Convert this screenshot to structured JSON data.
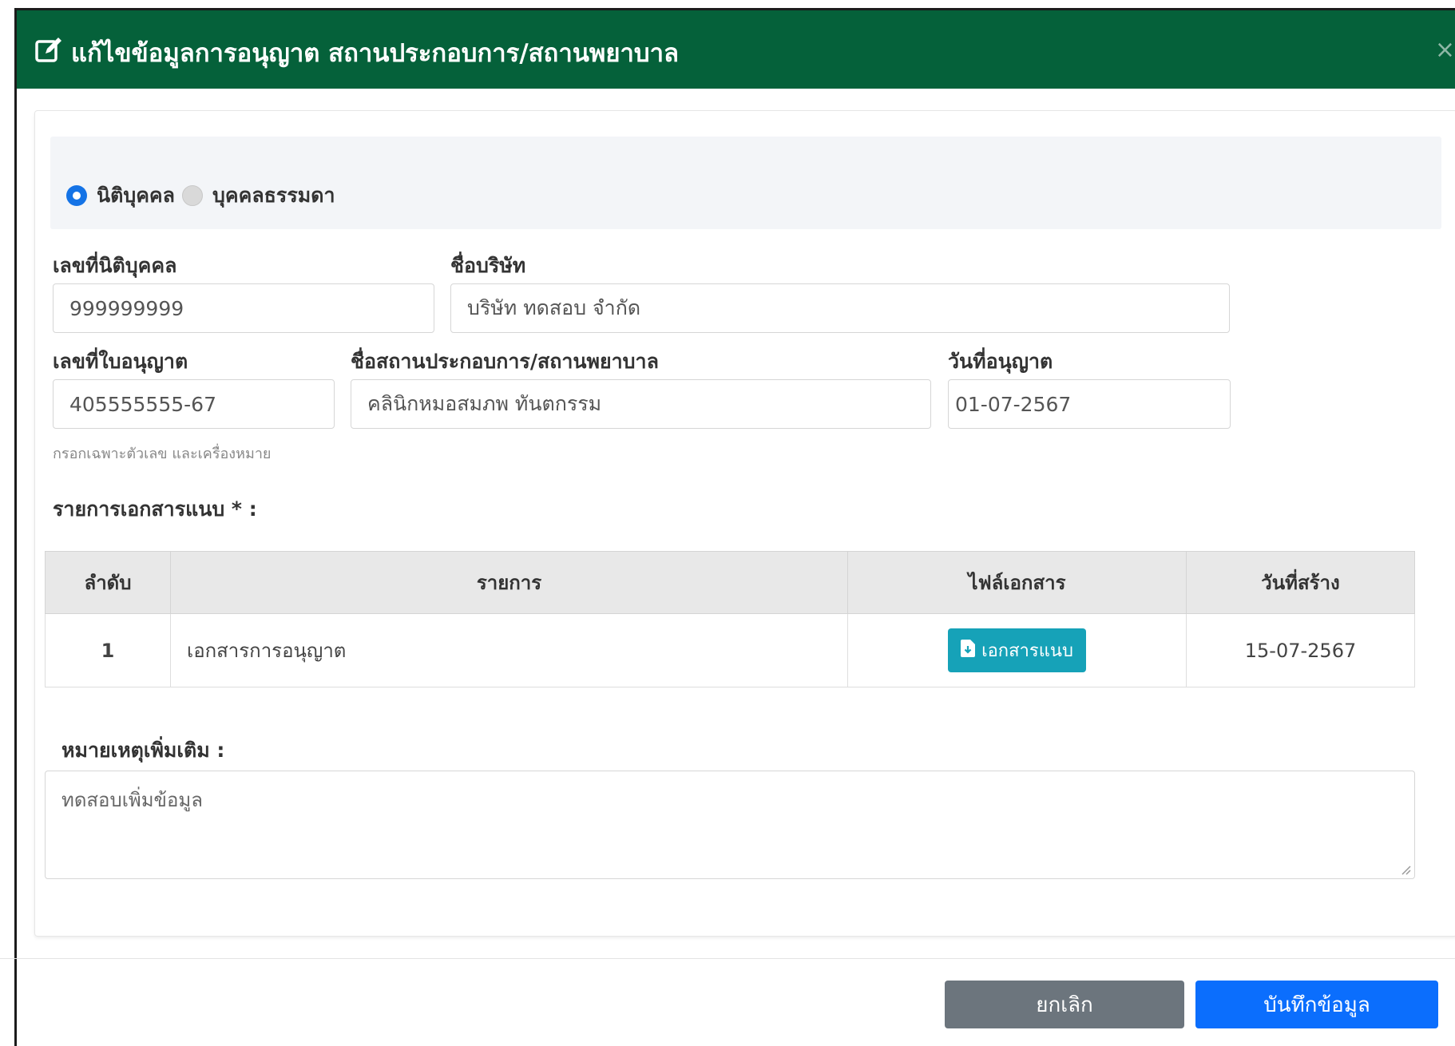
{
  "dialog": {
    "title": "แก้ไขข้อมูลการอนุญาต สถานประกอบการ/สถานพยาบาล",
    "close_glyph": "×",
    "header_color": "#05613a"
  },
  "person_type": {
    "options": [
      "นิติบุคคล",
      "บุคคลธรรมดา"
    ],
    "selected": "นิติบุคคล"
  },
  "form": {
    "juristic_id": {
      "label": "เลขที่นิติบุคคล",
      "value": "999999999"
    },
    "company_name": {
      "label": "ชื่อบริษัท",
      "value": "บริษัท ทดสอบ จำกัด"
    },
    "license_no": {
      "label": "เลขที่ใบอนุญาต",
      "value": "405555555-67",
      "hint": "กรอกเฉพาะตัวเลข และเครื่องหมาย"
    },
    "facility_name": {
      "label": "ชื่อสถานประกอบการ/สถานพยาบาล",
      "value": "คลินิกหมอสมภพ ทันตกรรม"
    },
    "license_date": {
      "label": "วันที่อนุญาต",
      "value": "01-07-2567"
    }
  },
  "documents": {
    "label": "รายการเอกสารแนบ * :",
    "columns": [
      "ลำดับ",
      "รายการ",
      "ไฟล์เอกสาร",
      "วันที่สร้าง"
    ],
    "rows": [
      {
        "no": "1",
        "item": "เอกสารการอนุญาต",
        "file_button": "เอกสารแนบ",
        "created": "15-07-2567"
      }
    ]
  },
  "remarks": {
    "label": "หมายเหตุเพิ่มเติม :",
    "value": "ทดสอบเพิ่มข้อมูล"
  },
  "footer": {
    "cancel_label": "ยกเลิก",
    "save_label": "บันทึกข้อมูล"
  },
  "colors": {
    "primary": "#0b6efd",
    "secondary": "#6c757d",
    "info": "#16a2b8",
    "radio_selected": "#1473e6"
  },
  "icons": {
    "title_icon": "edit-icon",
    "close_icon": "close-icon",
    "attach_icon": "file-download-icon"
  }
}
